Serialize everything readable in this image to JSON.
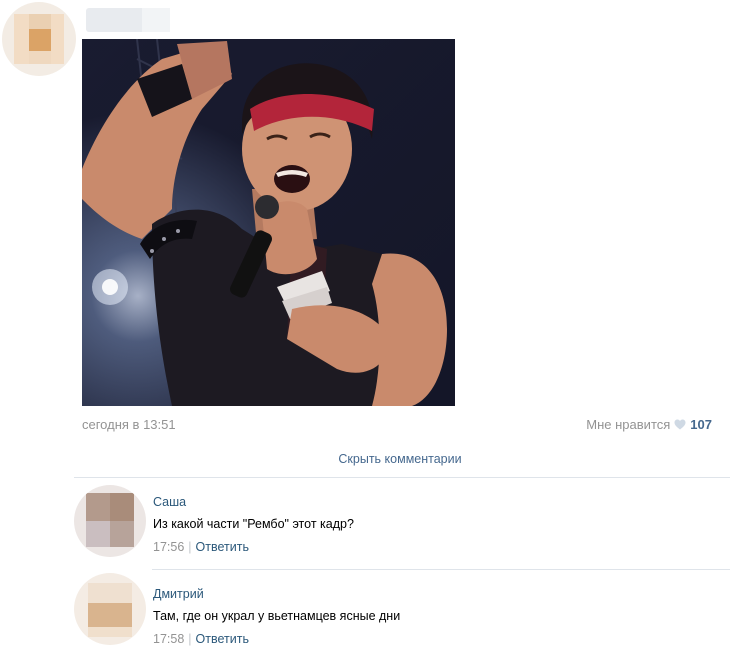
{
  "post": {
    "date": "сегодня в 13:51",
    "likes_label": "Мне нравится",
    "likes_count": "107",
    "photo_icon": "concert-singer-photo"
  },
  "comments_toggle": {
    "label": "Скрыть комментарии"
  },
  "comments": [
    {
      "name": "Саша",
      "text": "Из какой части \"Рембо\" этот кадр?",
      "time": "17:56",
      "reply": "Ответить"
    },
    {
      "name": "Дмитрий",
      "text": "Там, где он украл у вьетнамцев ясные дни",
      "time": "17:58",
      "reply": "Ответить"
    }
  ],
  "colors": {
    "link": "#2b587a",
    "muted": "#939393",
    "like_count": "#45688e",
    "divider": "#dfe4ea"
  }
}
